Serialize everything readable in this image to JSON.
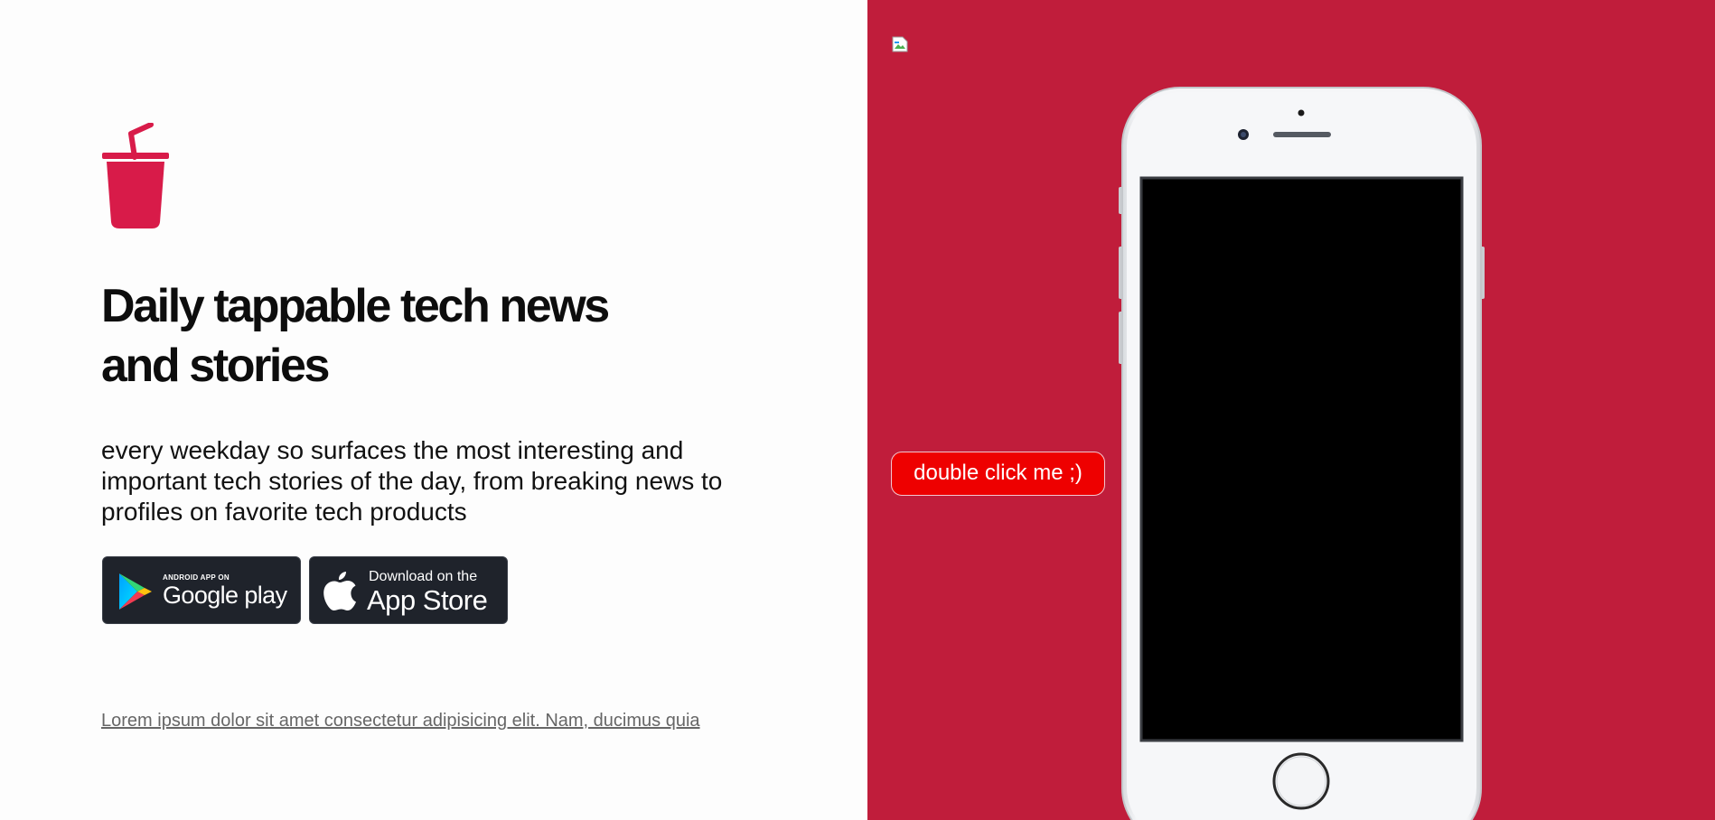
{
  "hero": {
    "logo_icon": "drink-cup-icon",
    "headline_line1": "Daily tappable tech news",
    "headline_line2": "and stories",
    "description": "every weekday so surfaces the most interesting and important tech stories of the day, from breaking news to profiles on favorite tech products"
  },
  "stores": {
    "google": {
      "icon": "google-play-icon",
      "small_label": "ANDROID APP ON",
      "big_label": "Google play"
    },
    "apple": {
      "icon": "apple-icon",
      "small_label": "Download on the",
      "big_label": "App Store"
    }
  },
  "footer": {
    "link_text": "Lorem ipsum dolor sit amet consectetur adipisicing elit. Nam, ducimus quia"
  },
  "showcase": {
    "broken_image_icon": "broken-image-icon",
    "double_click_label": "double click me ;)",
    "phone_icon": "iphone-mockup"
  },
  "colors": {
    "accent": "#c01d3b",
    "logo": "#d81b49",
    "button_red": "#ee0000",
    "store_button": "#1f232b"
  }
}
